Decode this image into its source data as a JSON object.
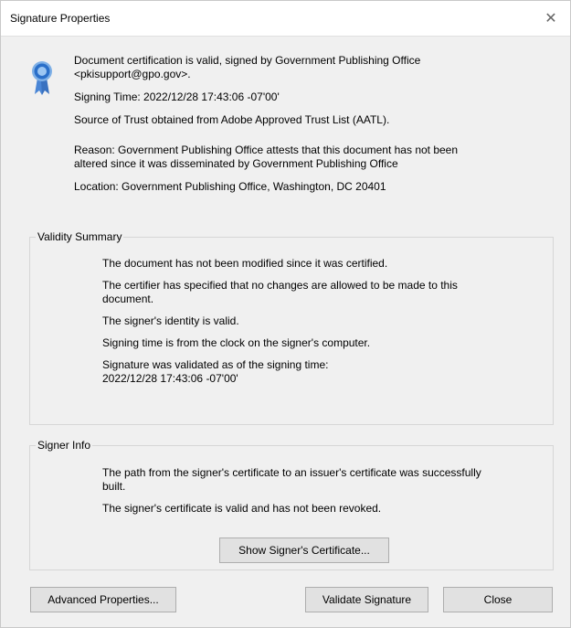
{
  "window": {
    "title": "Signature Properties",
    "close_glyph": "✕"
  },
  "certification": {
    "line1": "Document certification is valid, signed by Government Publishing Office",
    "line2": "<pkisupport@gpo.gov>.",
    "signing_time": "Signing Time:  2022/12/28 17:43:06 -07'00'",
    "trust_source": "Source of Trust obtained from Adobe Approved Trust List (AATL).",
    "reason_line1": "Reason:  Government Publishing Office attests that this document has not been",
    "reason_line2": "altered since it was disseminated by Government Publishing Office",
    "location": "Location:  Government Publishing Office, Washington, DC 20401"
  },
  "validity_summary": {
    "label": "Validity Summary",
    "not_modified": "The document has not been modified since it was certified.",
    "no_changes_line1": "The certifier has specified that no changes are allowed to be made to this",
    "no_changes_line2": "document.",
    "identity_valid": "The signer's identity is valid.",
    "signing_clock": "Signing time is from the clock on the signer's computer.",
    "validated_as_of": "Signature was validated as of the signing time:",
    "validated_time": "2022/12/28 17:43:06 -07'00'"
  },
  "signer_info": {
    "label": "Signer Info",
    "path_line1": "The path from the signer's certificate to an issuer's certificate was successfully",
    "path_line2": "built.",
    "cert_valid": "The signer's certificate is valid and has not been revoked.",
    "show_cert_button": "Show Signer's Certificate..."
  },
  "buttons": {
    "advanced": "Advanced Properties...",
    "validate": "Validate Signature",
    "close": "Close"
  },
  "background_fragment": "s",
  "colors": {
    "dialog_bg": "#f0f0f0",
    "button_bg": "#e1e1e1",
    "seal_blue": "#2a6fc9",
    "seal_ribbon": "#4a86d6"
  },
  "icons": {
    "seal": "certification-seal-icon",
    "close": "close-icon"
  }
}
